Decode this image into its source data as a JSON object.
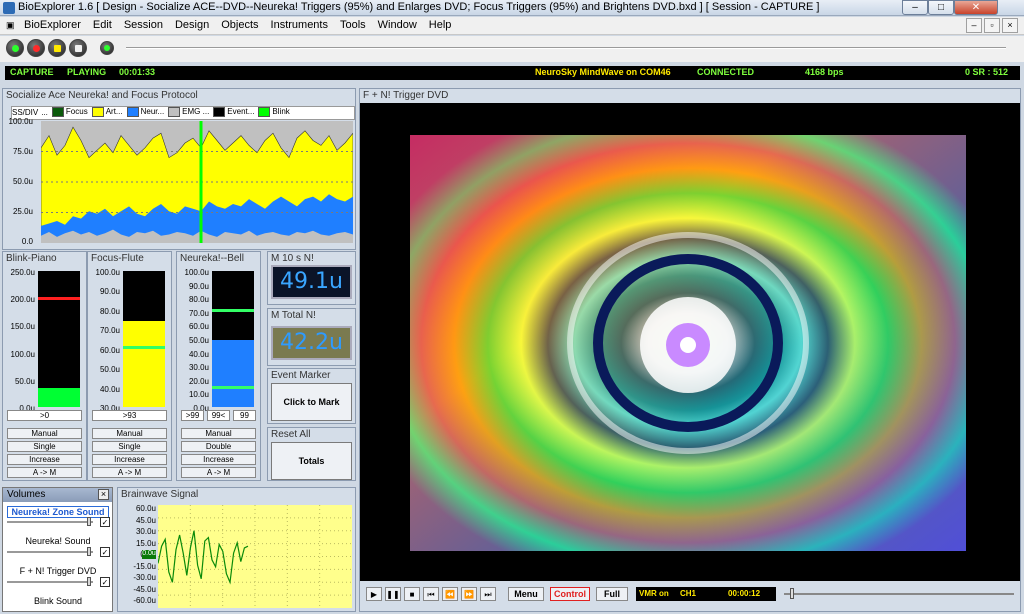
{
  "window": {
    "title": "BioExplorer 1.6  [ Design - Socialize ACE--DVD--Neureka! Triggers (95%) and Enlarges DVD; Focus Triggers (95%) and Brightens DVD.bxd ] [ Session - CAPTURE ]",
    "minimize": "–",
    "maximize": "□",
    "close": "✕"
  },
  "menu": {
    "items": [
      "BioExplorer",
      "Edit",
      "Session",
      "Design",
      "Objects",
      "Instruments",
      "Tools",
      "Window",
      "Help"
    ],
    "mdi": [
      "–",
      "▫",
      "×"
    ]
  },
  "transport": {
    "buttons": [
      "play-icon",
      "record-icon",
      "pause-icon",
      "stop-icon",
      "rewind-icon"
    ]
  },
  "status": {
    "mode": "CAPTURE",
    "state": "PLAYING",
    "time": "00:01:33",
    "device": "NeuroSky MindWave on COM46",
    "conn": "CONNECTED",
    "rate": "4168 bps",
    "sr": "0  SR : 512"
  },
  "topchart": {
    "title": "Socialize Ace Neureka! and Focus Protocol",
    "legend": [
      {
        "label": "SS/DIV",
        "color": null
      },
      {
        "label": "Focus",
        "color": "#0b5a0b"
      },
      {
        "label": "Art...",
        "color": "#ffff00"
      },
      {
        "label": "Neur...",
        "color": "#1f7fff"
      },
      {
        "label": "EMG ...",
        "color": "#c0c0c0"
      },
      {
        "label": "Event...",
        "color": "#000000"
      },
      {
        "label": "Blink",
        "color": "#00ff00"
      }
    ],
    "yticks": [
      "100.0u",
      "75.0u",
      "50.0u",
      "25.0u",
      "0.0"
    ],
    "legend_more": "...",
    "colors": {
      "art": "#ffff00",
      "neur": "#1f7fff",
      "emg": "#c0c0c0",
      "blink": "#00ff00"
    }
  },
  "chart_data": {
    "type": "area",
    "ylim": [
      0,
      100
    ],
    "yticks": [
      "100.0u",
      "75.0u",
      "50.0u",
      "25.0u",
      "0.0"
    ],
    "series": [
      {
        "name": "Art...",
        "values": [
          78,
          88,
          72,
          80,
          95,
          84,
          70,
          76,
          82,
          74,
          88,
          80,
          72,
          78,
          86,
          90,
          70,
          74,
          82,
          86,
          78,
          92,
          84,
          76,
          82,
          88,
          80,
          74,
          84,
          90,
          78,
          70,
          86,
          92,
          84,
          80,
          88,
          76,
          82,
          90
        ]
      },
      {
        "name": "Neur...",
        "values": [
          14,
          16,
          18,
          15,
          22,
          20,
          26,
          24,
          28,
          22,
          26,
          30,
          24,
          22,
          28,
          32,
          26,
          24,
          30,
          28,
          26,
          34,
          30,
          28,
          32,
          30,
          36,
          32,
          28,
          34,
          38,
          34,
          30,
          36,
          38,
          34,
          40,
          36,
          34,
          38
        ]
      },
      {
        "name": "EMG ...",
        "values": [
          6,
          9,
          5,
          8,
          10,
          7,
          9,
          6,
          8,
          11,
          7,
          5,
          9,
          8,
          10,
          6,
          7,
          9,
          8,
          6,
          10,
          7,
          5,
          9,
          8,
          7,
          10,
          6,
          8,
          9,
          7,
          6,
          9,
          8,
          10,
          7,
          6,
          8,
          9,
          7
        ]
      }
    ]
  },
  "bars": [
    {
      "title": "Blink-Piano",
      "scale": [
        "250.0u",
        "200.0u",
        "150.0u",
        "100.0u",
        "50.0u",
        "0.0u"
      ],
      "fill_frac": 0.14,
      "fill_color": "#00ff33",
      "marker_frac": 0.79,
      "marker_color": "#ff2020",
      "boxes": [
        ">0"
      ],
      "buttons": [
        "Manual",
        "Single",
        "Increase",
        "A -> M"
      ]
    },
    {
      "title": "Focus-Flute",
      "scale": [
        "100.0u",
        "90.0u",
        "80.0u",
        "70.0u",
        "60.0u",
        "50.0u",
        "40.0u",
        "30.0u"
      ],
      "fill_frac": 0.63,
      "fill_color": "#ffff00",
      "marker_frac": 0.43,
      "marker_color": "#33ff66",
      "boxes": [
        ">93"
      ],
      "buttons": [
        "Manual",
        "Single",
        "Increase",
        "A -> M"
      ]
    },
    {
      "title": "Neureka!--Bell",
      "scale": [
        "100.0u",
        "90.0u",
        "80.0u",
        "70.0u",
        "60.0u",
        "50.0u",
        "40.0u",
        "30.0u",
        "20.0u",
        "10.0u",
        "0.0u"
      ],
      "fill_frac": 0.49,
      "fill_color": "#1f7fff",
      "marker_frac": 0.13,
      "marker_color": "#33ff66",
      "marker2_frac": 0.7,
      "boxes": [
        ">99",
        "99<",
        "99"
      ],
      "buttons": [
        "Manual",
        "Double",
        "Increase",
        "A -> M"
      ]
    }
  ],
  "side": {
    "m10": {
      "title": "M 10 s N!",
      "value": "49.1u",
      "color": "#3aa6ff"
    },
    "mtotal": {
      "title": "M Total N!",
      "value": "42.2u",
      "color": "#3aa6ff"
    },
    "event": {
      "title": "Event Marker",
      "button": "Click to Mark"
    },
    "reset": {
      "title": "Reset All",
      "button": "Totals"
    }
  },
  "volumes": {
    "title": "Volumes",
    "close": "×",
    "rows": [
      {
        "label": "Neureka! Zone Sound",
        "checked": true,
        "level": 0.97,
        "active": true
      },
      {
        "label": "Neureka! Sound",
        "checked": true,
        "level": 0.97
      },
      {
        "label": "F + N! Trigger DVD",
        "checked": true,
        "level": 0.97
      },
      {
        "label": "Blink Sound",
        "checked": false,
        "level": 0.97
      }
    ],
    "check_mark": "✓"
  },
  "brain": {
    "title": "Brainwave Signal",
    "yticks": [
      "60.0u",
      "45.0u",
      "30.0u",
      "15.0u",
      "0.0u",
      "-15.0u",
      "-30.0u",
      "-45.0u",
      "-60.0u"
    ],
    "zero_label": "0.0u",
    "signal": [
      -8,
      12,
      20,
      -18,
      -30,
      8,
      25,
      4,
      -22,
      10,
      30,
      -10,
      -26,
      18,
      22,
      -4,
      -12,
      14,
      6,
      -20,
      -30,
      4,
      16,
      -6,
      10,
      12
    ]
  },
  "dvd": {
    "title": "F + N! Trigger DVD",
    "menu_btn": "Menu",
    "control_btn": "Control",
    "full_btn": "Full",
    "vmr": "VMR on",
    "ch": "CH1",
    "time": "00:00:12",
    "buttons": [
      "▶",
      "❚❚",
      "■",
      "⏮",
      "⏪",
      "⏩",
      "⏭"
    ]
  }
}
